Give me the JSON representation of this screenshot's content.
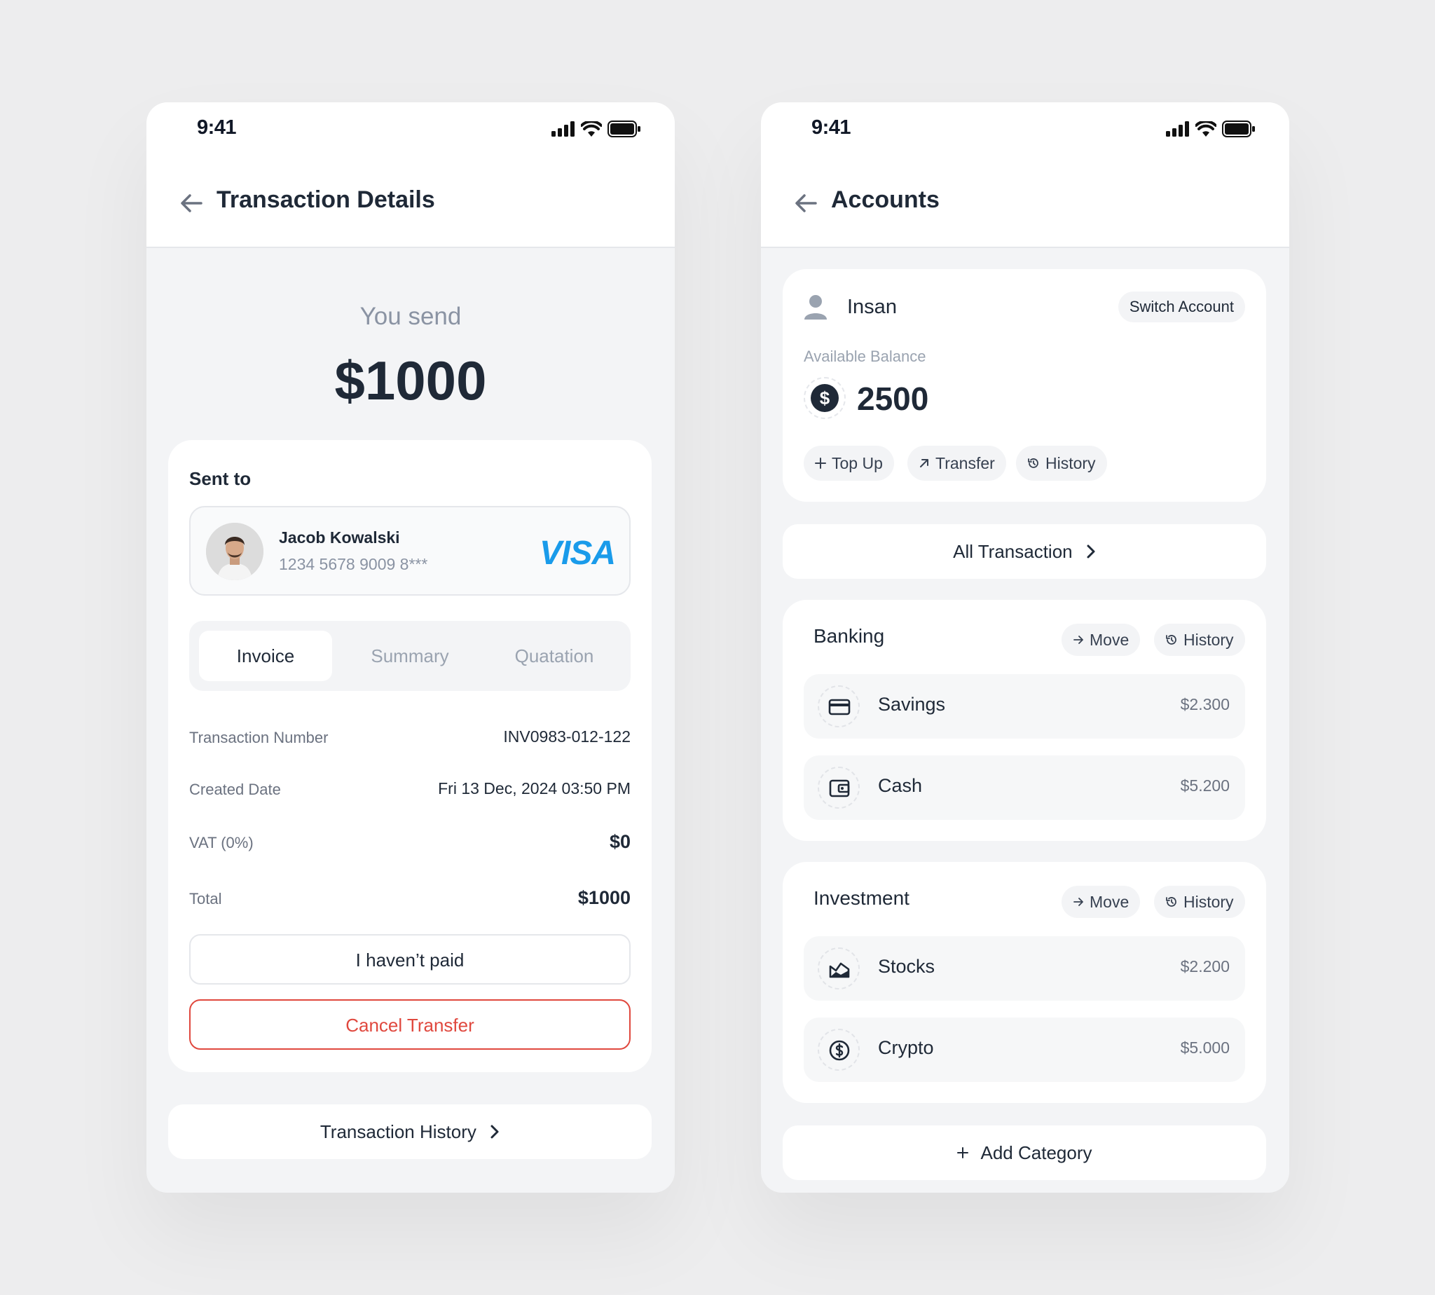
{
  "left": {
    "status_time": "9:41",
    "title": "Transaction Details",
    "you_send_label": "You send",
    "amount": "$1000",
    "sent_to_label": "Sent to",
    "recipient": {
      "name": "Jacob Kowalski",
      "card": "1234 5678 9009 8***",
      "brand": "VISA"
    },
    "tabs": [
      "Invoice",
      "Summary",
      "Quatation"
    ],
    "details": [
      {
        "label": "Transaction Number",
        "value": "INV0983-012-122"
      },
      {
        "label": "Created Date",
        "value": "Fri 13 Dec, 2024 03:50 PM"
      },
      {
        "label": "VAT (0%)",
        "value": "$0"
      },
      {
        "label": "Total",
        "value": "$1000"
      }
    ],
    "btn_not_paid": "I haven’t paid",
    "btn_cancel": "Cancel Transfer",
    "history_link": "Transaction History"
  },
  "right": {
    "status_time": "9:41",
    "title": "Accounts",
    "account_name": "Insan",
    "switch_label": "Switch Account",
    "available_label": "Available Balance",
    "currency_symbol": "$",
    "balance": "2500",
    "actions": {
      "topup": "Top Up",
      "transfer": "Transfer",
      "history": "History"
    },
    "all_transaction": "All Transaction",
    "banking": {
      "title": "Banking",
      "move": "Move",
      "history": "History",
      "items": [
        {
          "name": "Savings",
          "value": "$2.300",
          "icon": "card-icon"
        },
        {
          "name": "Cash",
          "value": "$5.200",
          "icon": "wallet-icon"
        }
      ]
    },
    "investment": {
      "title": "Investment",
      "move": "Move",
      "history": "History",
      "items": [
        {
          "name": "Stocks",
          "value": "$2.200",
          "icon": "chart-icon"
        },
        {
          "name": "Crypto",
          "value": "$5.000",
          "icon": "dollar-coin-icon"
        }
      ]
    },
    "add_category": "Add Category"
  },
  "colors": {
    "accent_red": "#e0483e",
    "visa_blue": "#1a9bea",
    "text_dark": "#1f2937",
    "muted": "#8a93a3"
  }
}
